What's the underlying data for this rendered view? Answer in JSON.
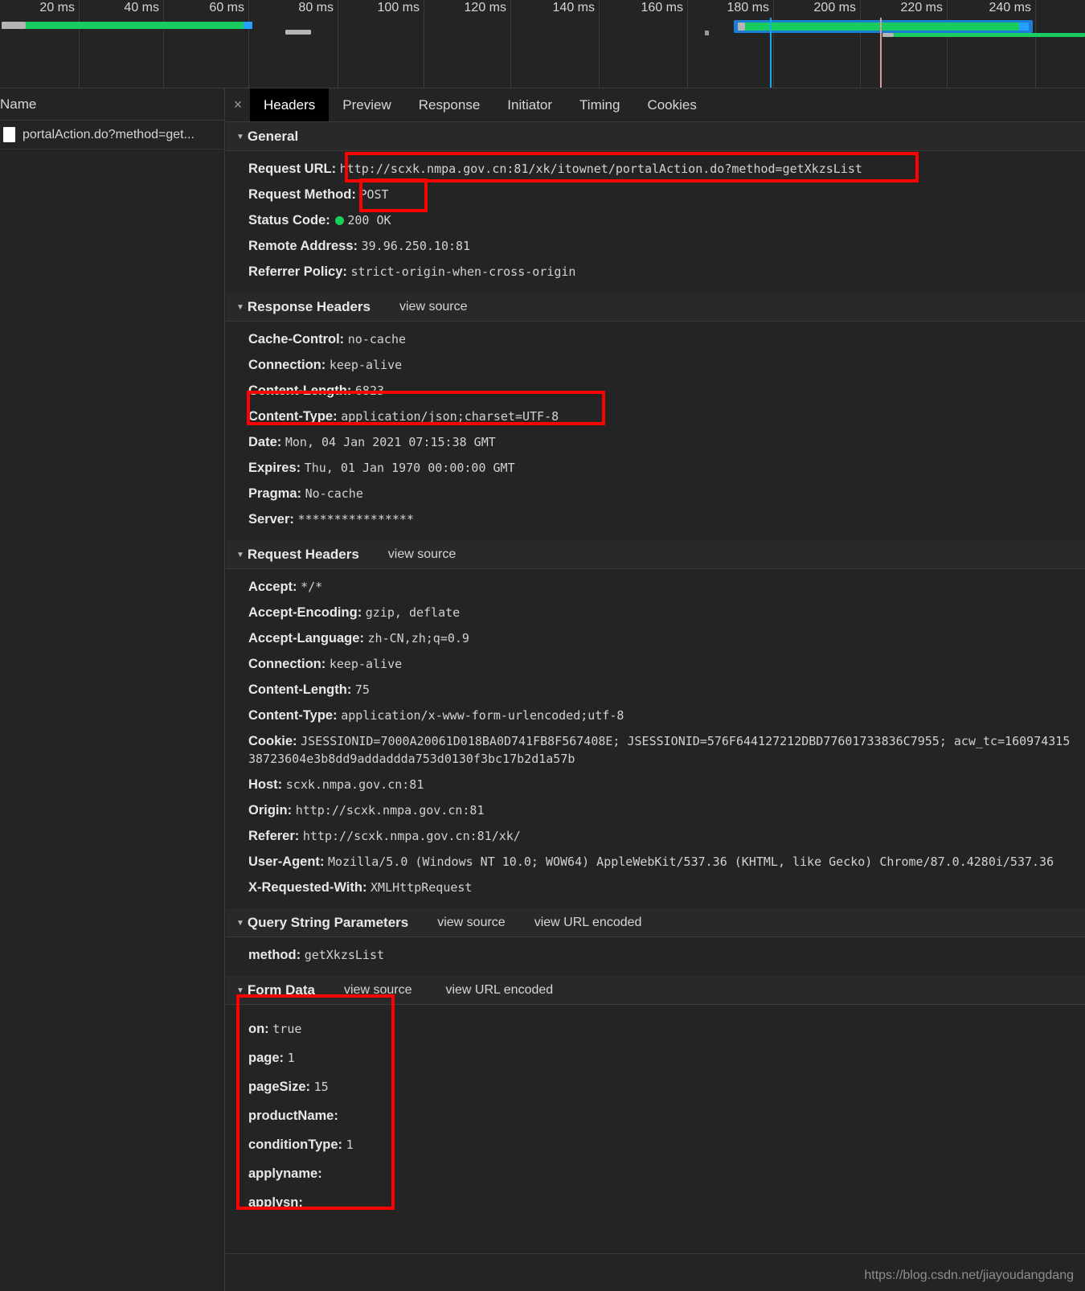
{
  "timeline": {
    "ticks": [
      "20 ms",
      "40 ms",
      "60 ms",
      "80 ms",
      "100 ms",
      "120 ms",
      "140 ms",
      "160 ms",
      "180 ms",
      "200 ms",
      "220 ms",
      "240 ms"
    ],
    "colors": {
      "green": "#19cc5f",
      "blue": "#24a0ff",
      "grey": "#b5b5b5",
      "selection": "#1a7fd4"
    }
  },
  "requests_panel": {
    "column_header": "Name",
    "rows": [
      {
        "name": "portalAction.do?method=get...",
        "icon": "document-icon"
      }
    ]
  },
  "tabs": {
    "close_label": "×",
    "items": [
      {
        "label": "Headers",
        "active": true
      },
      {
        "label": "Preview",
        "active": false
      },
      {
        "label": "Response",
        "active": false
      },
      {
        "label": "Initiator",
        "active": false
      },
      {
        "label": "Timing",
        "active": false
      },
      {
        "label": "Cookies",
        "active": false
      }
    ]
  },
  "general": {
    "title": "General",
    "rows": [
      {
        "key": "Request URL",
        "sep": ":",
        "value": "http://scxk.nmpa.gov.cn:81/xk/itownet/portalAction.do?method=getXkzsList"
      },
      {
        "key": "Request Method",
        "sep": ":",
        "value": "POST"
      },
      {
        "key": "Status Code",
        "sep": ":",
        "value": "200 OK",
        "status_dot": "#1ad05c"
      },
      {
        "key": "Remote Address",
        "sep": ":",
        "value": "39.96.250.10:81"
      },
      {
        "key": "Referrer Policy",
        "sep": ":",
        "value": "strict-origin-when-cross-origin"
      }
    ]
  },
  "response_headers": {
    "title": "Response Headers",
    "view_source": "view source",
    "rows": [
      {
        "key": "Cache-Control",
        "value": "no-cache"
      },
      {
        "key": "Connection",
        "value": "keep-alive"
      },
      {
        "key": "Content-Length",
        "value": "6823"
      },
      {
        "key": "Content-Type",
        "value": "application/json;charset=UTF-8"
      },
      {
        "key": "Date",
        "value": "Mon, 04 Jan 2021 07:15:38 GMT"
      },
      {
        "key": "Expires",
        "value": "Thu, 01 Jan 1970 00:00:00 GMT"
      },
      {
        "key": "Pragma",
        "value": "No-cache"
      },
      {
        "key": "Server",
        "value": "****************"
      }
    ]
  },
  "request_headers": {
    "title": "Request Headers",
    "view_source": "view source",
    "rows": [
      {
        "key": "Accept",
        "value": "*/*"
      },
      {
        "key": "Accept-Encoding",
        "value": "gzip, deflate"
      },
      {
        "key": "Accept-Language",
        "value": "zh-CN,zh;q=0.9"
      },
      {
        "key": "Connection",
        "value": "keep-alive"
      },
      {
        "key": "Content-Length",
        "value": "75"
      },
      {
        "key": "Content-Type",
        "value": "application/x-www-form-urlencoded;utf-8"
      },
      {
        "key": "Cookie",
        "value": "JSESSIONID=7000A20061D018BA0D741FB8F567408E; JSESSIONID=576F644127212DBD77601733836C7955; acw_tc=16097431538723604e3b8dd9addaddda753d0130f3bc17b2d1a57b"
      },
      {
        "key": "Host",
        "value": "scxk.nmpa.gov.cn:81"
      },
      {
        "key": "Origin",
        "value": "http://scxk.nmpa.gov.cn:81"
      },
      {
        "key": "Referer",
        "value": "http://scxk.nmpa.gov.cn:81/xk/"
      },
      {
        "key": "User-Agent",
        "value": "Mozilla/5.0 (Windows NT 10.0; WOW64) AppleWebKit/537.36 (KHTML, like Gecko) Chrome/87.0.4280i/537.36"
      },
      {
        "key": "X-Requested-With",
        "value": "XMLHttpRequest"
      }
    ]
  },
  "query_string_parameters": {
    "title": "Query String Parameters",
    "view_source": "view source",
    "view_url_encoded": "view URL encoded",
    "rows": [
      {
        "key": "method",
        "value": "getXkzsList"
      }
    ]
  },
  "form_data": {
    "title": "Form Data",
    "view_source": "view source",
    "view_url_encoded": "view URL encoded",
    "rows": [
      {
        "key": "on",
        "value": "true"
      },
      {
        "key": "page",
        "value": "1"
      },
      {
        "key": "pageSize",
        "value": "15"
      },
      {
        "key": "productName",
        "value": ""
      },
      {
        "key": "conditionType",
        "value": "1"
      },
      {
        "key": "applyname",
        "value": ""
      },
      {
        "key": "applysn",
        "value": ""
      }
    ]
  },
  "annotations": {
    "color": "#ff0000",
    "boxes": [
      "request-url",
      "request-method",
      "content-type",
      "form-data"
    ]
  },
  "watermark": {
    "text": "https://blog.csdn.net/jiayoudangdang"
  }
}
